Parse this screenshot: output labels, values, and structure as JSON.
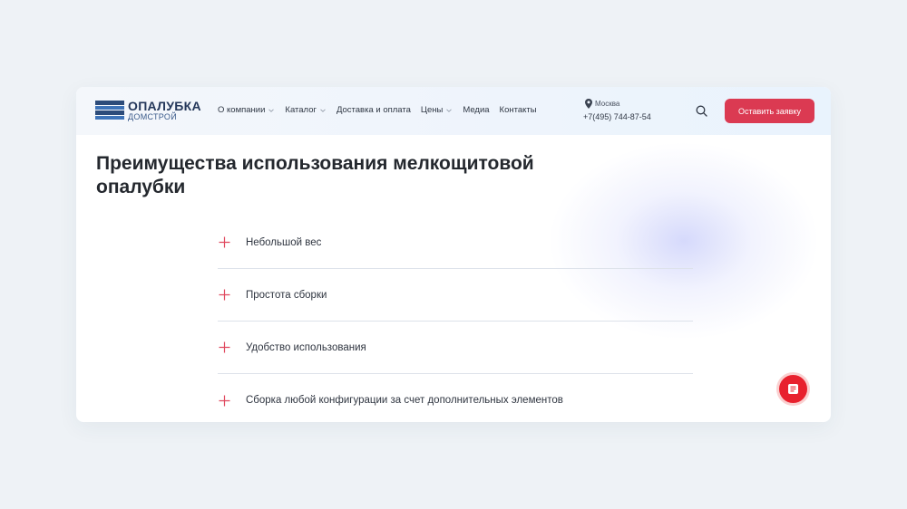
{
  "header": {
    "logo": {
      "main": "ОПАЛУБКА",
      "sub": "ДОМСТРОЙ"
    },
    "nav": [
      {
        "label": "О компании",
        "has_dropdown": true
      },
      {
        "label": "Каталог",
        "has_dropdown": true
      },
      {
        "label": "Доставка и оплата",
        "has_dropdown": false
      },
      {
        "label": "Цены",
        "has_dropdown": true
      },
      {
        "label": "Медиа",
        "has_dropdown": false
      },
      {
        "label": "Контакты",
        "has_dropdown": false
      }
    ],
    "city": "Москва",
    "phone": "+7(495) 744-87-54",
    "cta_label": "Оставить заявку"
  },
  "main": {
    "title_line1": "Преимущества использования мелкощитовой",
    "title_line2": "опалубки",
    "accordion": [
      {
        "label": "Небольшой вес"
      },
      {
        "label": "Простота сборки"
      },
      {
        "label": "Удобство использования"
      },
      {
        "label": "Сборка любой конфигурации за счет дополнительных элементов"
      }
    ]
  },
  "colors": {
    "accent": "#db3a52",
    "fab": "#e8212e",
    "brand": "#24375a"
  },
  "icons": {
    "search": "search-icon",
    "location": "map-pin-icon",
    "expand": "plus-icon",
    "fab": "document-icon"
  }
}
